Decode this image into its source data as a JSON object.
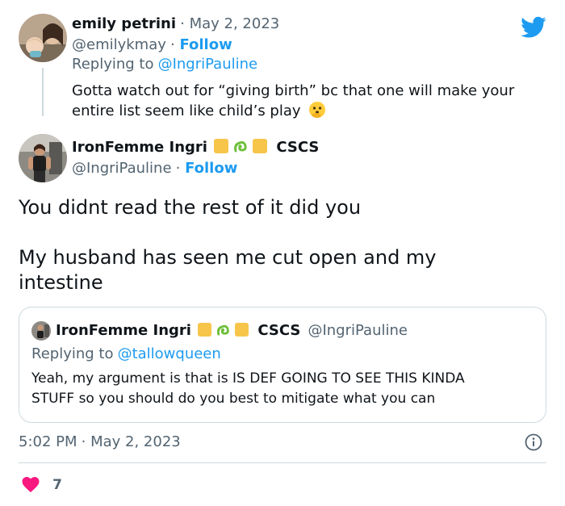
{
  "reply": {
    "name": "emily petrini",
    "date": "May 2, 2023",
    "handle": "@emilykmay",
    "follow": "Follow",
    "replying_prefix": "Replying to",
    "replying_handle": "@IngriPauline",
    "text_line1": "Gotta watch out for “giving birth” bc that one will make your",
    "text_line2": "entire list seem like child’s play",
    "emoji": "face-with-open-eyes-and-hand-over-mouth-emoji"
  },
  "main": {
    "name": "IronFemme Ingri",
    "name_suffix": "CSCS",
    "handle": "@IngriPauline",
    "follow": "Follow",
    "text_line1": "You didnt read the rest of it did you",
    "text_line2": "My husband has seen me cut open and my",
    "text_line3": "intestine"
  },
  "quoted": {
    "name": "IronFemme Ingri",
    "name_suffix": "CSCS",
    "handle": "@IngriPauline",
    "replying_prefix": "Replying to",
    "replying_handle": "@tallowqueen",
    "text_line1": "Yeah, my argument is that is IS DEF GOING TO SEE THIS KINDA",
    "text_line2": "STUFF so you should do you best to mitigate what you can"
  },
  "footer": {
    "time": "5:02 PM",
    "date": "May 2, 2023",
    "likes": "7"
  },
  "colors": {
    "accent": "#1d9bf0",
    "like": "#f91880",
    "badge": "#f7c54a",
    "muted": "#536471"
  }
}
